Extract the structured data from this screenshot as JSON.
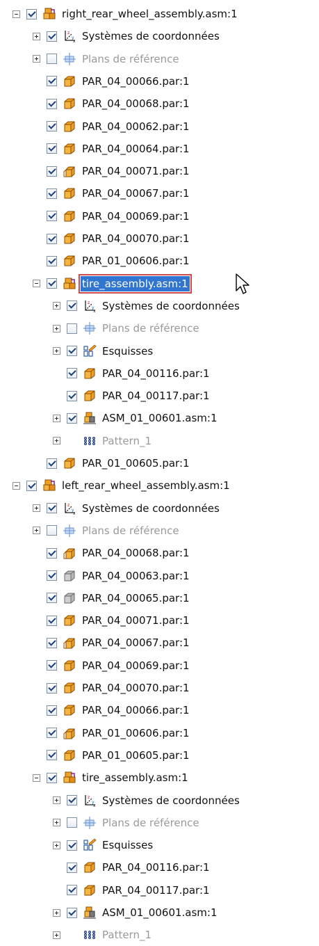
{
  "tree": [
    {
      "depth": 0,
      "expander": "minus",
      "check": "on",
      "icon": "assembly-icon",
      "label": "right_rear_wheel_assembly.asm:1"
    },
    {
      "depth": 1,
      "expander": "plus",
      "check": "on",
      "icon": "coordinate-system-icon",
      "label": "Systèmes de coordonnées"
    },
    {
      "depth": 1,
      "expander": "plus",
      "check": "off",
      "icon": "reference-planes-icon",
      "label": "Plans de référence",
      "dim": true
    },
    {
      "depth": 1,
      "expander": "none",
      "check": "on",
      "icon": "part-icon",
      "label": "PAR_04_00066.par:1"
    },
    {
      "depth": 1,
      "expander": "none",
      "check": "on",
      "icon": "part-icon",
      "label": "PAR_04_00068.par:1"
    },
    {
      "depth": 1,
      "expander": "none",
      "check": "on",
      "icon": "part-icon",
      "label": "PAR_04_00062.par:1"
    },
    {
      "depth": 1,
      "expander": "none",
      "check": "on",
      "icon": "part-icon",
      "label": "PAR_04_00064.par:1"
    },
    {
      "depth": 1,
      "expander": "none",
      "check": "on",
      "icon": "sheet-part-icon",
      "label": "PAR_04_00071.par:1"
    },
    {
      "depth": 1,
      "expander": "none",
      "check": "on",
      "icon": "part-icon",
      "label": "PAR_04_00067.par:1"
    },
    {
      "depth": 1,
      "expander": "none",
      "check": "on",
      "icon": "part-icon",
      "label": "PAR_04_00069.par:1"
    },
    {
      "depth": 1,
      "expander": "none",
      "check": "on",
      "icon": "part-icon",
      "label": "PAR_04_00070.par:1"
    },
    {
      "depth": 1,
      "expander": "none",
      "check": "on",
      "icon": "part-icon",
      "label": "PAR_01_00606.par:1"
    },
    {
      "depth": 1,
      "expander": "minus",
      "check": "on",
      "icon": "assembly-icon",
      "label": "tire_assembly.asm:1",
      "selected": true
    },
    {
      "depth": 2,
      "expander": "plus",
      "check": "on",
      "icon": "coordinate-system-icon",
      "label": "Systèmes de coordonnées"
    },
    {
      "depth": 2,
      "expander": "plus",
      "check": "off",
      "icon": "reference-planes-icon",
      "label": "Plans de référence",
      "dim": true
    },
    {
      "depth": 2,
      "expander": "plus",
      "check": "on",
      "icon": "sketch-icon",
      "label": "Esquisses"
    },
    {
      "depth": 2,
      "expander": "none",
      "check": "on",
      "icon": "part-icon",
      "label": "PAR_04_00116.par:1"
    },
    {
      "depth": 2,
      "expander": "none",
      "check": "on",
      "icon": "part-icon",
      "label": "PAR_04_00117.par:1"
    },
    {
      "depth": 2,
      "expander": "plus",
      "check": "on",
      "icon": "subassembly-icon",
      "label": "ASM_01_00601.asm:1"
    },
    {
      "depth": 2,
      "expander": "plus",
      "check": "none",
      "icon": "pattern-icon",
      "label": "Pattern_1",
      "dim": true
    },
    {
      "depth": 1,
      "expander": "none",
      "check": "on",
      "icon": "part-icon",
      "label": "PAR_01_00605.par:1"
    },
    {
      "depth": 0,
      "expander": "minus",
      "check": "on",
      "icon": "assembly-icon",
      "label": "left_rear_wheel_assembly.asm:1"
    },
    {
      "depth": 1,
      "expander": "plus",
      "check": "on",
      "icon": "coordinate-system-icon",
      "label": "Systèmes de coordonnées"
    },
    {
      "depth": 1,
      "expander": "plus",
      "check": "off",
      "icon": "reference-planes-icon",
      "label": "Plans de référence",
      "dim": true
    },
    {
      "depth": 1,
      "expander": "none",
      "check": "on",
      "icon": "sheet-part-icon",
      "label": "PAR_04_00068.par:1"
    },
    {
      "depth": 1,
      "expander": "none",
      "check": "on",
      "icon": "grey-part-icon",
      "label": "PAR_04_00063.par:1"
    },
    {
      "depth": 1,
      "expander": "none",
      "check": "on",
      "icon": "grey-part-icon",
      "label": "PAR_04_00065.par:1"
    },
    {
      "depth": 1,
      "expander": "none",
      "check": "on",
      "icon": "part-icon",
      "label": "PAR_04_00071.par:1"
    },
    {
      "depth": 1,
      "expander": "none",
      "check": "on",
      "icon": "sheet-part-icon",
      "label": "PAR_04_00067.par:1"
    },
    {
      "depth": 1,
      "expander": "none",
      "check": "on",
      "icon": "part-icon",
      "label": "PAR_04_00069.par:1"
    },
    {
      "depth": 1,
      "expander": "none",
      "check": "on",
      "icon": "part-icon",
      "label": "PAR_04_00070.par:1"
    },
    {
      "depth": 1,
      "expander": "none",
      "check": "on",
      "icon": "part-icon",
      "label": "PAR_04_00066.par:1"
    },
    {
      "depth": 1,
      "expander": "none",
      "check": "on",
      "icon": "sheet-part-icon",
      "label": "PAR_01_00606.par:1"
    },
    {
      "depth": 1,
      "expander": "none",
      "check": "on",
      "icon": "part-icon",
      "label": "PAR_01_00605.par:1"
    },
    {
      "depth": 1,
      "expander": "minus",
      "check": "on",
      "icon": "assembly-icon",
      "label": "tire_assembly.asm:1"
    },
    {
      "depth": 2,
      "expander": "plus",
      "check": "on",
      "icon": "coordinate-system-icon",
      "label": "Systèmes de coordonnées"
    },
    {
      "depth": 2,
      "expander": "plus",
      "check": "off",
      "icon": "reference-planes-icon",
      "label": "Plans de référence",
      "dim": true
    },
    {
      "depth": 2,
      "expander": "plus",
      "check": "on",
      "icon": "sketch-icon",
      "label": "Esquisses"
    },
    {
      "depth": 2,
      "expander": "none",
      "check": "on",
      "icon": "part-icon",
      "label": "PAR_04_00116.par:1"
    },
    {
      "depth": 2,
      "expander": "none",
      "check": "on",
      "icon": "part-icon",
      "label": "PAR_04_00117.par:1"
    },
    {
      "depth": 2,
      "expander": "plus",
      "check": "on",
      "icon": "subassembly-icon",
      "label": "ASM_01_00601.asm:1"
    },
    {
      "depth": 2,
      "expander": "plus",
      "check": "none",
      "icon": "pattern-icon",
      "label": "Pattern_1",
      "dim": true
    }
  ],
  "colors": {
    "selection": "#3075d0",
    "selection_border": "#d24a4a",
    "dim_text": "#9a9a9a",
    "part_orange": "#f0a022",
    "part_grey": "#b8b8b8"
  }
}
